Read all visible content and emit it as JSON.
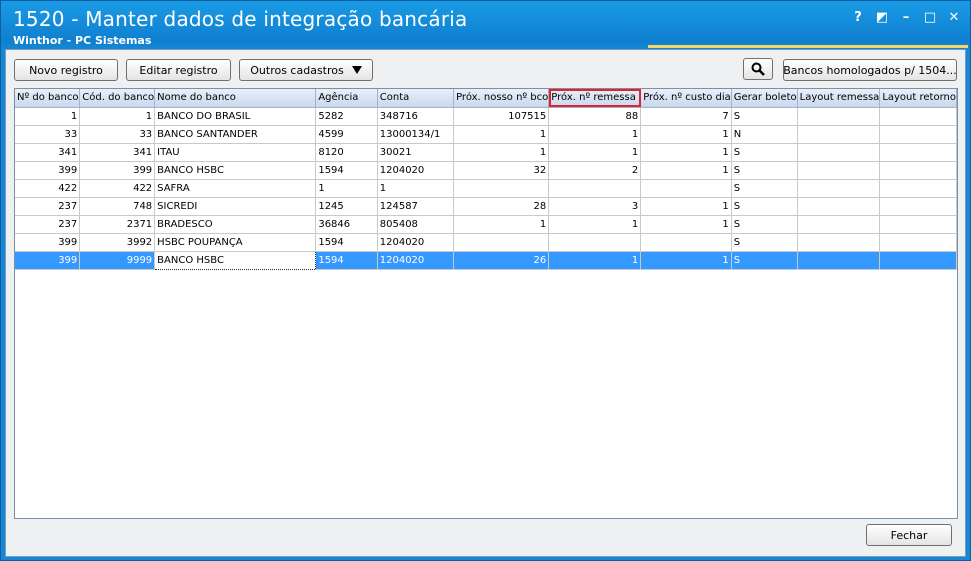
{
  "window": {
    "title": "1520 - Manter dados de integração bancária",
    "subtitle": "Winthor - PC Sistemas",
    "controls": [
      "?",
      "◩",
      "–",
      "□",
      "✕"
    ]
  },
  "toolbar": {
    "new_label": "Novo registro",
    "edit_label": "Editar registro",
    "other_label": "Outros cadastros",
    "search_icon": "search-icon",
    "banks_label": "Bancos homologados p/ 1504..."
  },
  "grid": {
    "columns": [
      "Nº do banco",
      "Cód. do banco",
      "Nome do banco",
      "Agência",
      "Conta",
      "Próx. nosso nº bco",
      "Próx. nº remessa",
      "Próx. nº custo dia",
      "Gerar boleto",
      "Layout remessa",
      "Layout retorno"
    ],
    "highlighted_column": "Próx. nº remessa",
    "rows": [
      [
        "1",
        "1",
        "BANCO DO BRASIL",
        "5282",
        "348716",
        "107515",
        "88",
        "7",
        "S",
        "",
        ""
      ],
      [
        "33",
        "33",
        "BANCO SANTANDER",
        "4599",
        "13000134/1",
        "1",
        "1",
        "1",
        "N",
        "",
        ""
      ],
      [
        "341",
        "341",
        "ITAU",
        "8120",
        "30021",
        "1",
        "1",
        "1",
        "S",
        "",
        ""
      ],
      [
        "399",
        "399",
        "BANCO HSBC",
        "1594",
        "1204020",
        "32",
        "2",
        "1",
        "S",
        "",
        ""
      ],
      [
        "422",
        "422",
        "SAFRA",
        "1",
        "1",
        "",
        "",
        "",
        "S",
        "",
        ""
      ],
      [
        "237",
        "748",
        "SICREDI",
        "1245",
        "124587",
        "28",
        "3",
        "1",
        "S",
        "",
        ""
      ],
      [
        "237",
        "2371",
        "BRADESCO",
        "36846",
        "805408",
        "1",
        "1",
        "1",
        "S",
        "",
        ""
      ],
      [
        "399",
        "3992",
        "HSBC POUPANÇA",
        "1594",
        "1204020",
        "",
        "",
        "",
        "S",
        "",
        ""
      ],
      [
        "399",
        "9999",
        "BANCO HSBC",
        "1594",
        "1204020",
        "26",
        "1",
        "1",
        "S",
        "",
        ""
      ]
    ],
    "selected_row": 8
  },
  "footer": {
    "close_label": "Fechar"
  }
}
